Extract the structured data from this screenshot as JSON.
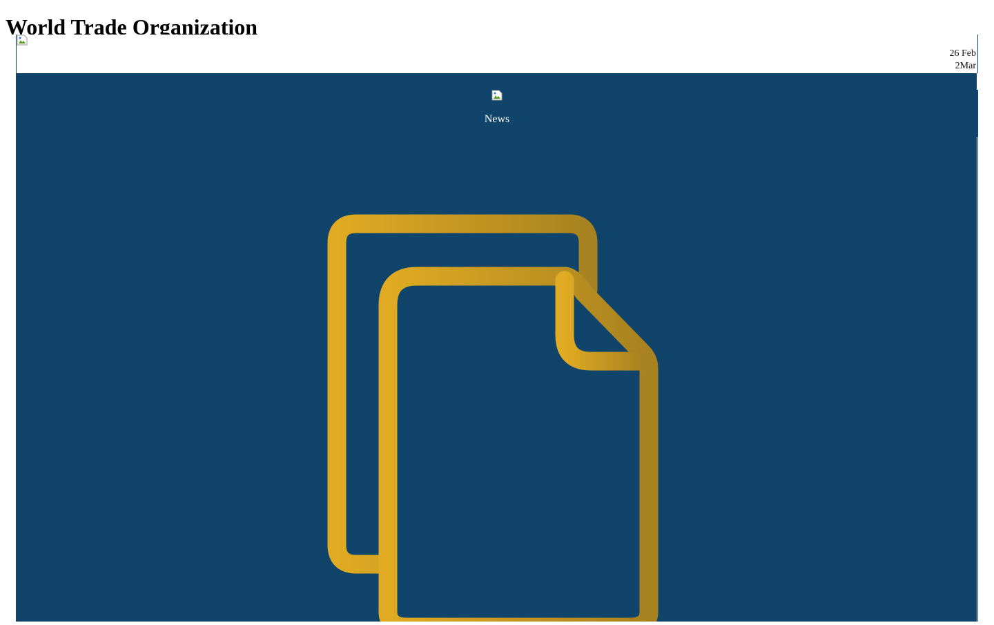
{
  "header": {
    "organization_title": "World Trade Organization"
  },
  "event": {
    "start_date": "26 Feb",
    "end_date": "2Mar"
  },
  "section": {
    "label": "News",
    "icon": "document-copy-icon"
  },
  "colors": {
    "panel_background": "#10446a",
    "icon_gold_light": "#e0ab22",
    "icon_gold_dark": "#a88220",
    "label_text": "#ffffff"
  }
}
